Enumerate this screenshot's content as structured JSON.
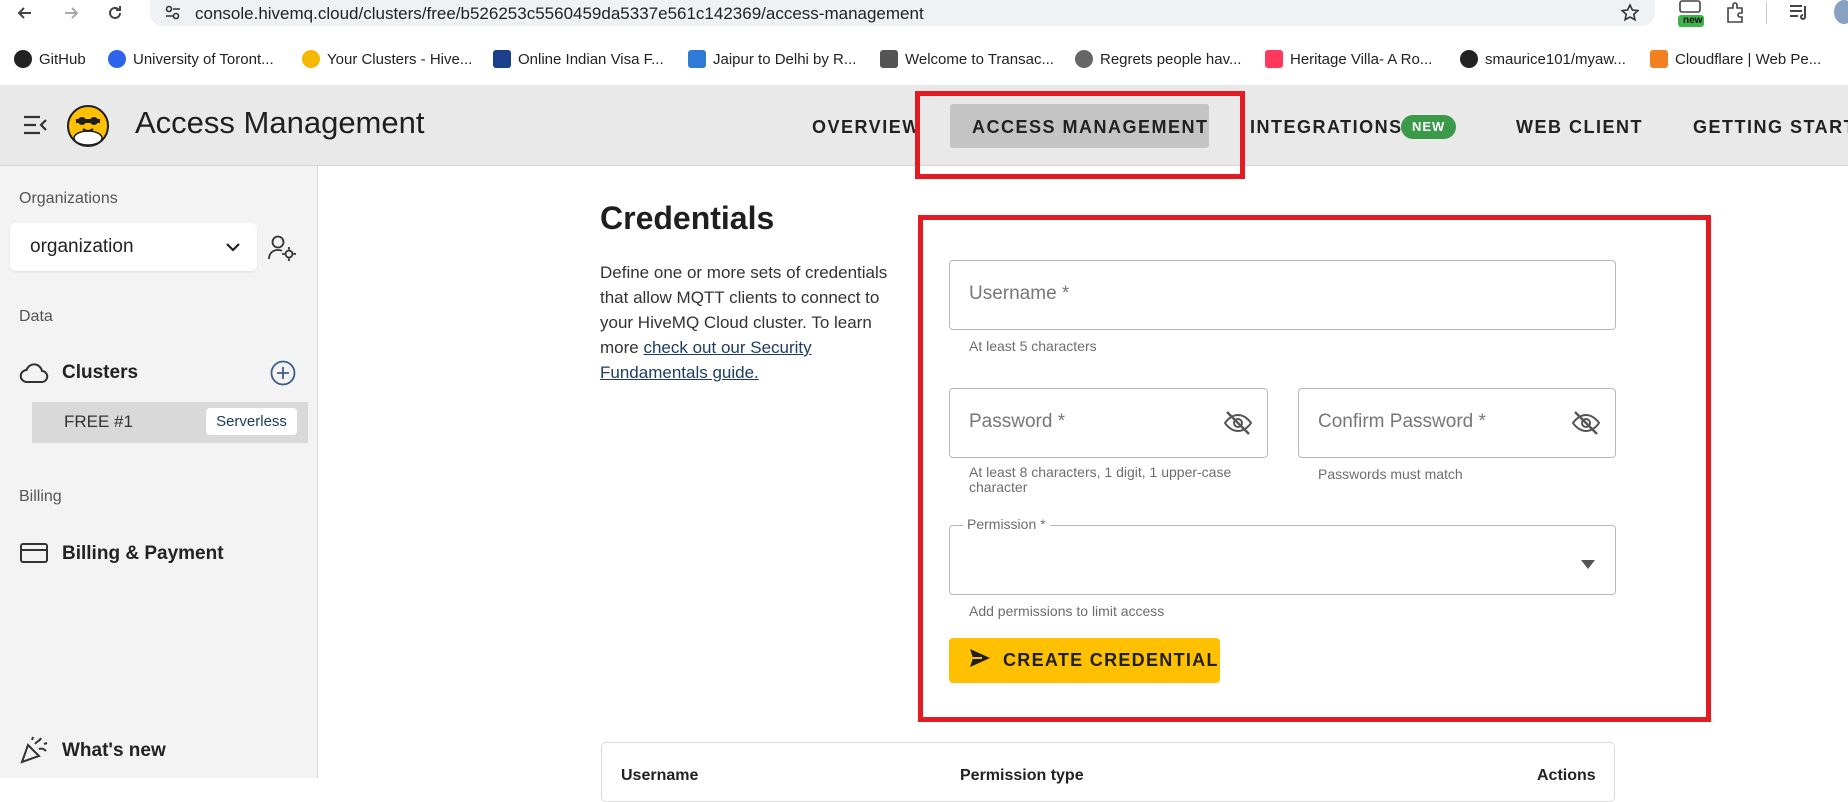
{
  "browser": {
    "url": "console.hivemq.cloud/clusters/free/b526253c5560459da5337e561c142369/access-management",
    "new_badge": "new",
    "bookmarks": [
      {
        "label": "GitHub",
        "icon": "github-icon",
        "color": "#222222"
      },
      {
        "label": "University of Toront...",
        "icon": "zoom-icon",
        "color": "#2d63ea"
      },
      {
        "label": "Your Clusters - Hive...",
        "icon": "hivemq-icon",
        "color": "#f5b800"
      },
      {
        "label": "Online Indian Visa F...",
        "icon": "nic-icon",
        "color": "#1b3f8b"
      },
      {
        "label": "Jaipur to Delhi by R...",
        "icon": "s-icon",
        "color": "#2f7ad6"
      },
      {
        "label": "Welcome to Transac...",
        "icon": "bank-icon",
        "color": "#555555"
      },
      {
        "label": "Regrets people hav...",
        "icon": "globe-icon",
        "color": "#666666"
      },
      {
        "label": "Heritage Villa- A Ro...",
        "icon": "airbnb-icon",
        "color": "#ff385c"
      },
      {
        "label": "smaurice101/myaw...",
        "icon": "github-icon",
        "color": "#222222"
      },
      {
        "label": "Cloudflare | Web Pe...",
        "icon": "cloudflare-icon",
        "color": "#f38020"
      }
    ]
  },
  "header": {
    "title": "Access Management",
    "tabs": {
      "overview": "OVERVIEW",
      "access": "ACCESS MANAGEMENT",
      "integrations": "INTEGRATIONS",
      "integrations_badge": "NEW",
      "webclient": "WEB CLIENT",
      "getting_started": "GETTING STARTE"
    }
  },
  "sidebar": {
    "organizations_label": "Organizations",
    "org_value": "organization",
    "data_label": "Data",
    "clusters_label": "Clusters",
    "cluster_name": "FREE #1",
    "cluster_badge": "Serverless",
    "billing_label": "Billing",
    "billing_item": "Billing & Payment",
    "whats_new": "What's new"
  },
  "main": {
    "title": "Credentials",
    "desc_text": "Define one or more sets of credentials that allow MQTT clients to connect to your HiveMQ Cloud cluster. To learn more ",
    "desc_link": "check out our Security Fundamentals guide.",
    "username_placeholder": "Username *",
    "username_helper": "At least 5 characters",
    "password_placeholder": "Password *",
    "password_helper": "At least 8 characters, 1 digit, 1 upper-case character",
    "confirm_placeholder": "Confirm Password *",
    "confirm_helper": "Passwords must match",
    "permission_label": "Permission *",
    "permission_helper": "Add permissions to limit access",
    "create_button": "CREATE CREDENTIAL",
    "table_headers": {
      "username": "Username",
      "permission": "Permission type",
      "actions": "Actions"
    }
  },
  "colors": {
    "accent": "#ffc000",
    "highlight": "#e31b23",
    "badge_green": "#3b9a4a",
    "link": "#1d3d63"
  }
}
